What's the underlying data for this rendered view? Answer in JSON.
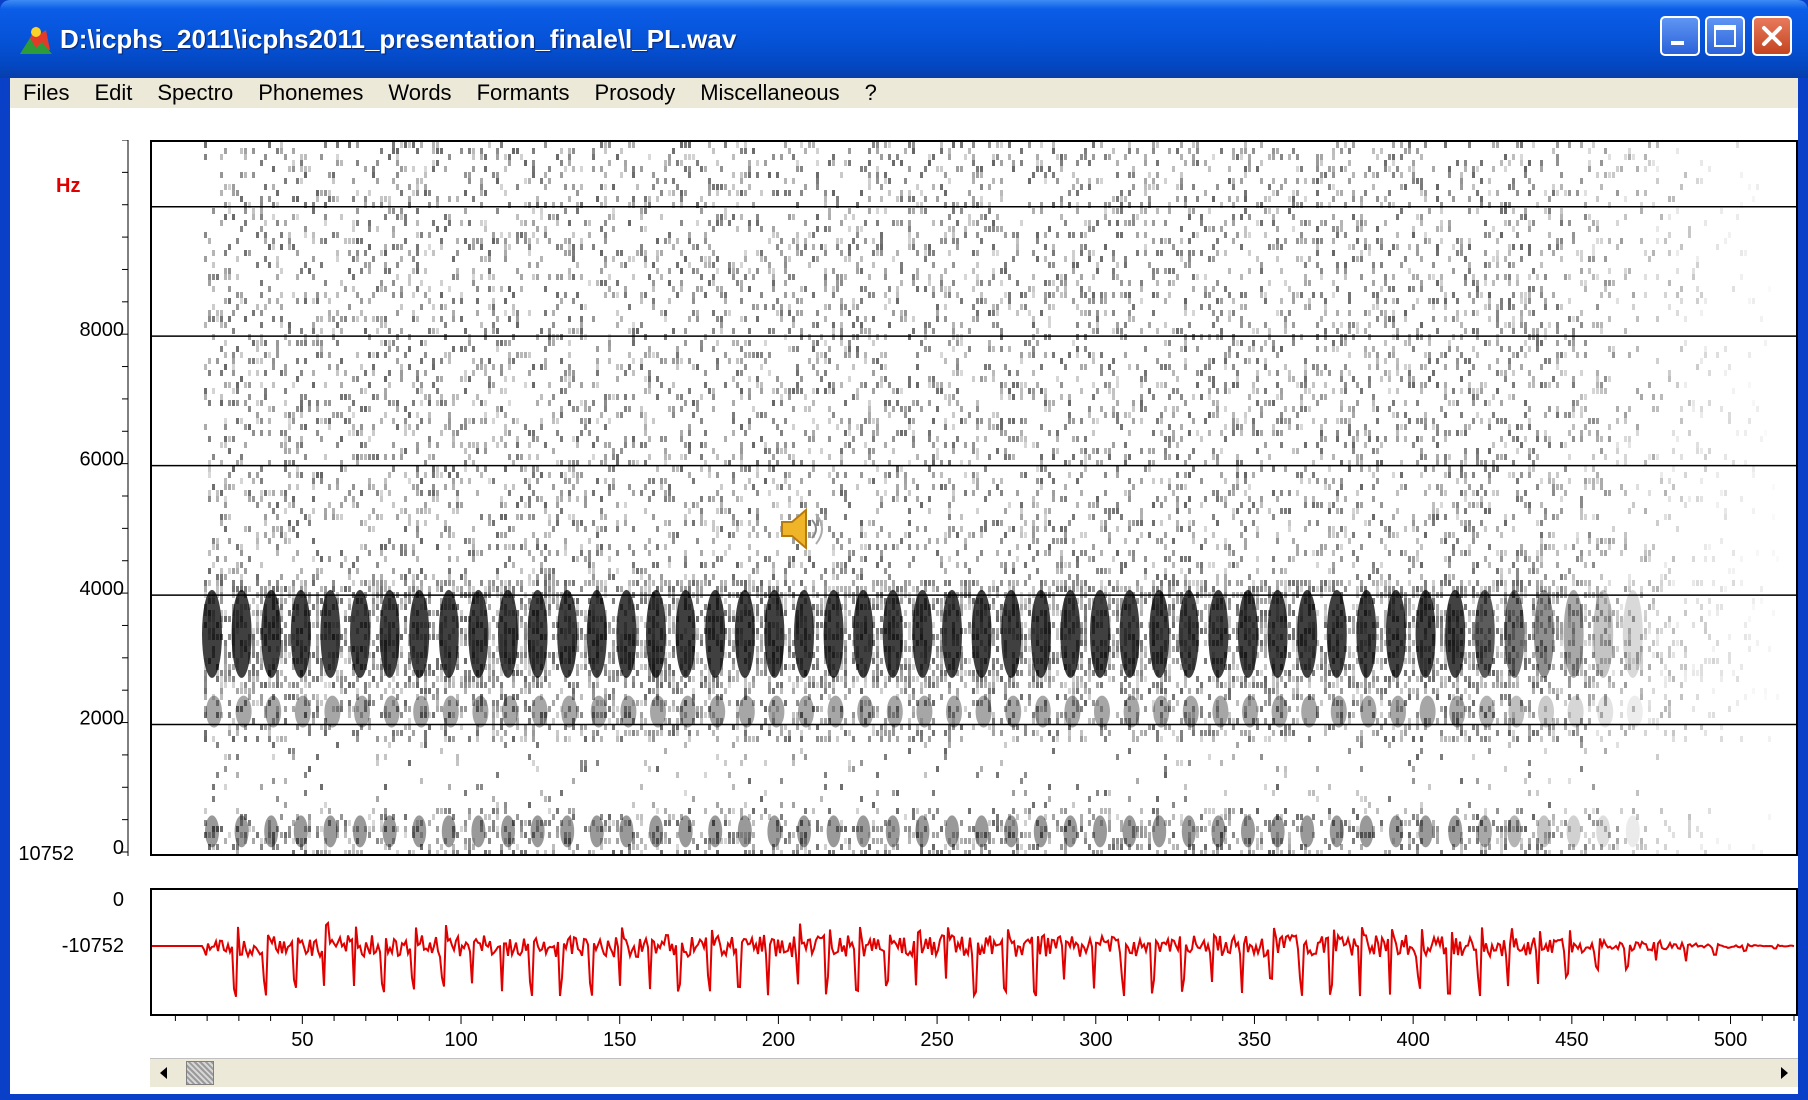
{
  "window": {
    "title": "D:\\icphs_2011\\icphs2011_presentation_finale\\l_PL.wav",
    "controls": [
      "minimize",
      "maximize",
      "close"
    ]
  },
  "menu": {
    "items": [
      "Files",
      "Edit",
      "Spectro",
      "Phonemes",
      "Words",
      "Formants",
      "Prosody",
      "Miscellaneous",
      "?"
    ]
  },
  "spectrogram": {
    "unit_label": "Hz",
    "y_ticks": [
      "8000",
      "6000",
      "4000",
      "2000",
      "0"
    ],
    "y_values": [
      8000,
      6000,
      4000,
      2000,
      0
    ],
    "y_max": 11000,
    "gridlines_hz": [
      10000,
      8000,
      6000,
      4000,
      2000
    ],
    "colors": {
      "ink": "#000000",
      "background": "#ffffff"
    },
    "overlay_icon": "speaker-icon"
  },
  "waveform": {
    "y_labels": [
      "10752",
      "0",
      "-10752"
    ],
    "y_max": 10752,
    "color": "#e00000"
  },
  "time_axis": {
    "ticks": [
      "50",
      "100",
      "150",
      "200",
      "250",
      "300",
      "350",
      "400",
      "450",
      "500"
    ],
    "tick_values": [
      50,
      100,
      150,
      200,
      250,
      300,
      350,
      400,
      450,
      500
    ],
    "range": [
      2,
      520
    ]
  },
  "scrollbar": {
    "left_icon": "scroll-left-arrow-icon",
    "right_icon": "scroll-right-arrow-icon"
  }
}
